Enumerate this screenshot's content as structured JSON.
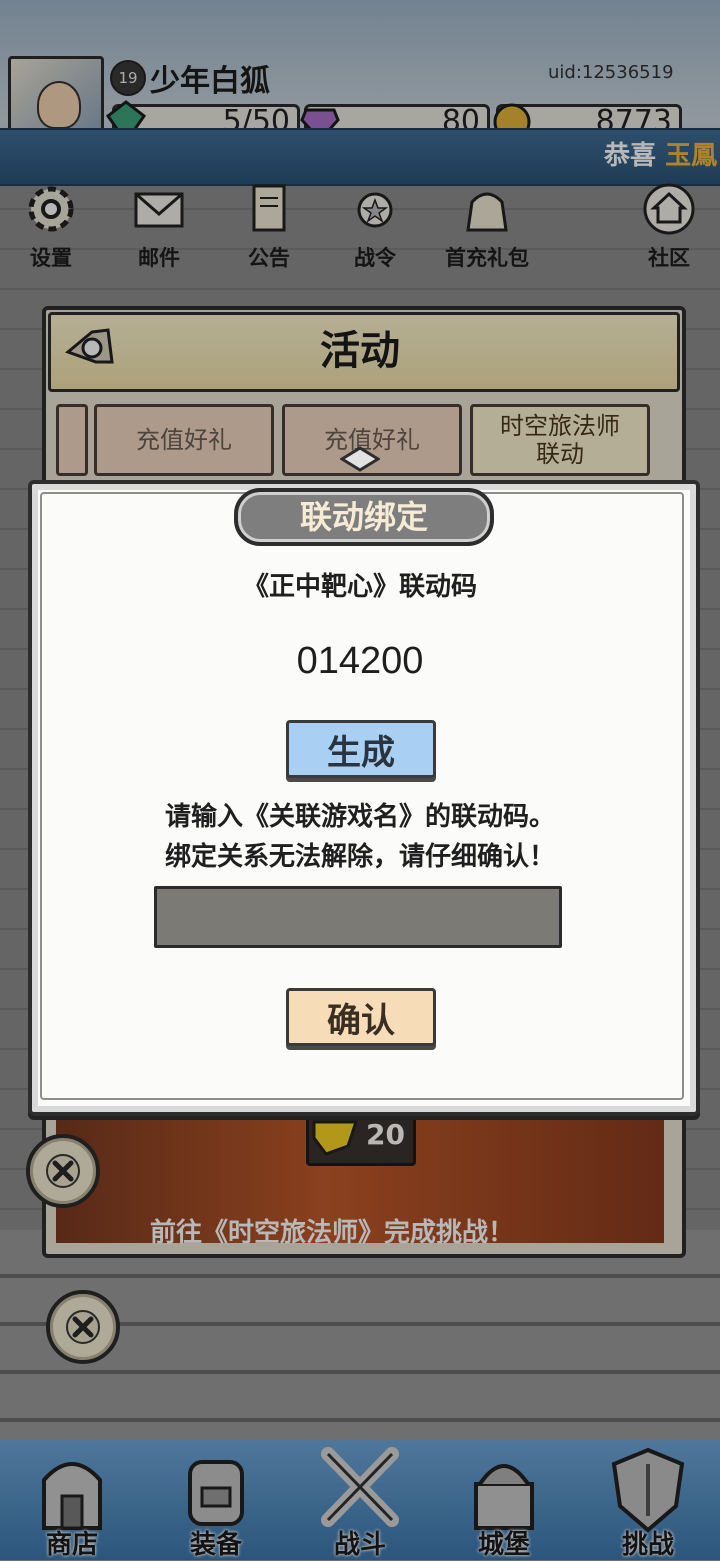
{
  "player": {
    "level": "19",
    "name": "少年白狐",
    "uid": "uid:12536519"
  },
  "resources": [
    {
      "icon": "stamina-gem-icon",
      "value": "5/50"
    },
    {
      "icon": "purple-gem-icon",
      "value": "80"
    },
    {
      "icon": "gold-coin-icon",
      "value": "8773"
    }
  ],
  "ticker": {
    "prefix": "恭喜",
    "highlight": "玉鳳"
  },
  "menu": [
    {
      "label": "设置",
      "icon": "gear-icon"
    },
    {
      "label": "邮件",
      "icon": "envelope-icon"
    },
    {
      "label": "公告",
      "icon": "scroll-icon"
    },
    {
      "label": "战令",
      "icon": "medal-icon"
    },
    {
      "label": "首充礼包",
      "icon": "gift-bag-icon"
    },
    {
      "label": "社区",
      "icon": "home-icon"
    }
  ],
  "activity": {
    "title": "活动",
    "tabs": [
      "充值好礼",
      "时空旅法师\n联动"
    ],
    "banner_reward": "20",
    "banner_text": "前往《时空旅法师》完成挑战！"
  },
  "dialog": {
    "title": "联动绑定",
    "code_label": "《正中靶心》联动码",
    "code_value": "014200",
    "generate_label": "生成",
    "instruction_line1": "请输入《关联游戏名》的联动码。",
    "instruction_line2": "绑定关系无法解除，请仔细确认！",
    "input_value": "",
    "confirm_label": "确认"
  },
  "bottom_nav": [
    {
      "label": "商店",
      "icon": "shop-icon"
    },
    {
      "label": "装备",
      "icon": "backpack-icon"
    },
    {
      "label": "战斗",
      "icon": "crossed-swords-icon"
    },
    {
      "label": "城堡",
      "icon": "castle-icon"
    },
    {
      "label": "挑战",
      "icon": "shield-icon"
    }
  ],
  "colors": {
    "news_bar": "#2c5478",
    "generate_button": "#a9d0f2",
    "confirm_button": "#f6ddb8",
    "dialog_title_bg": "#7e7e7e"
  }
}
